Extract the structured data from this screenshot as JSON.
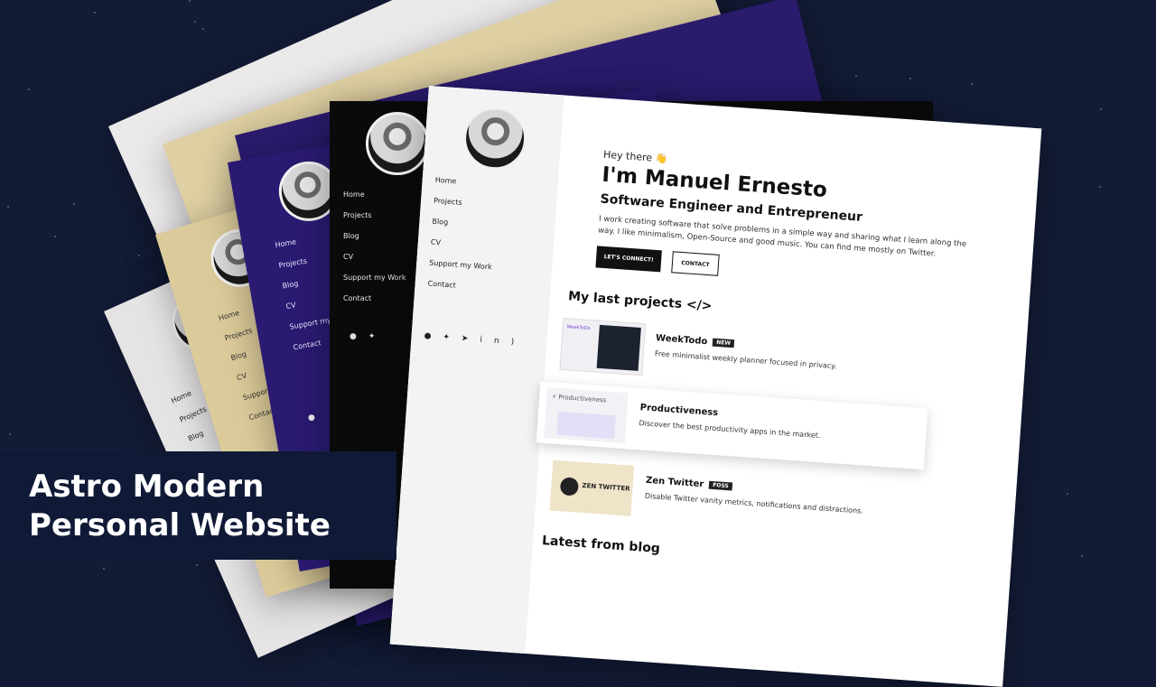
{
  "banner": {
    "line1": "Astro Modern",
    "line2": "Personal Website"
  },
  "site": {
    "greeting": "Hey there 👋",
    "name": "I'm Manuel Ernesto",
    "role": "Software Engineer and Entrepreneur",
    "bio": "I work creating software that solve problems in a simple way and sharing what I learn along the way. I like minimalism, Open-Source and good music. You can find me mostly on Twitter.",
    "primary_button": "LET'S CONNECT!",
    "secondary_button": "CONTACT",
    "projects_heading": "My last projects </>",
    "blog_heading": "Latest from blog",
    "nav": [
      "Home",
      "Projects",
      "Blog",
      "CV",
      "Support my Work",
      "Contact"
    ],
    "nav_cut": [
      "Home",
      "Projects",
      "Blog",
      "CV",
      "Support my Wo",
      "Contact"
    ],
    "nav_cut2": [
      "Home",
      "Projects",
      "Blog",
      "CV",
      "Support my Wor",
      "Contact"
    ],
    "social_icons": [
      "github-icon",
      "twitter-icon",
      "telegram-icon",
      "linkedin-icon",
      "rss-icon"
    ],
    "projects": [
      {
        "title": "WeekTodo",
        "badge": "NEW",
        "desc": "Free minimalist weekly planner focused in privacy.",
        "thumb_text": "WeekToDo"
      },
      {
        "title": "Productiveness",
        "badge": "",
        "desc": "Discover the best productivity apps in the market.",
        "thumb_text": "⚡ Productiveness"
      },
      {
        "title": "Zen Twitter",
        "badge": "FOSS",
        "desc": "Disable Twitter vanity metrics, notifications and distractions.",
        "thumb_text": "ZEN TWITTER"
      }
    ]
  },
  "themes": {
    "light_gray": "#e7e5e6",
    "beige": "#d8c89d",
    "purple": "#2a1a6b",
    "black": "#0b0b0b",
    "white": "#ffffff",
    "background": "#131b36"
  }
}
